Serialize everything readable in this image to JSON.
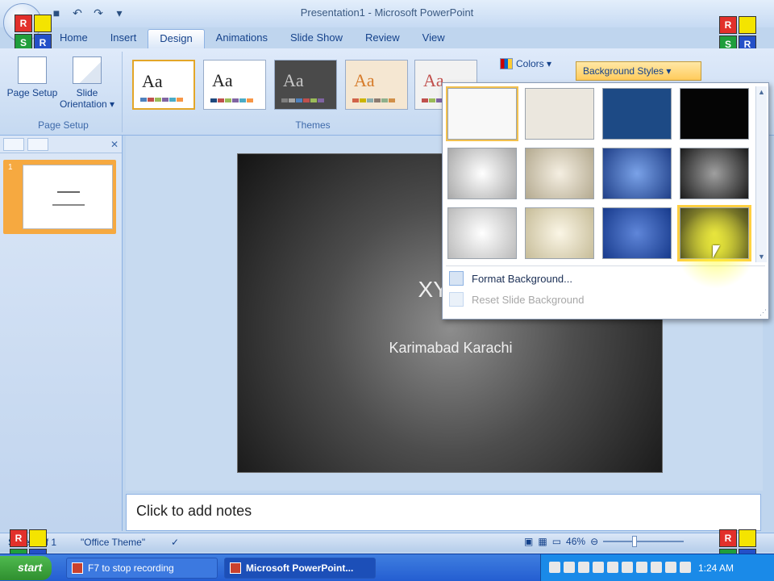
{
  "window": {
    "title": "Presentation1 - Microsoft PowerPoint",
    "controls": [
      "–",
      "□",
      "✕"
    ]
  },
  "quick_access": [
    "save-icon",
    "undo-icon",
    "redo-icon",
    "customize-icon"
  ],
  "watermark_logo": {
    "letters": [
      "R",
      "",
      "S",
      "R"
    ]
  },
  "tabs": [
    {
      "label": "Home"
    },
    {
      "label": "Insert"
    },
    {
      "label": "Design",
      "active": true
    },
    {
      "label": "Animations"
    },
    {
      "label": "Slide Show"
    },
    {
      "label": "Review"
    },
    {
      "label": "View"
    }
  ],
  "ribbon": {
    "page_setup": {
      "group_label": "Page Setup",
      "page_setup_label": "Page Setup",
      "orientation_label": "Slide Orientation ▾"
    },
    "themes": {
      "group_label": "Themes",
      "items": [
        {
          "label": "Aa",
          "bg": "#ffffff",
          "fg": "#222222",
          "bars": [
            "#4f81bd",
            "#c0504d",
            "#9bbb59",
            "#8064a2",
            "#4bacc6",
            "#f79646"
          ],
          "active": true
        },
        {
          "label": "Aa",
          "bg": "#ffffff",
          "fg": "#222222",
          "bars": [
            "#1f497d",
            "#c0504d",
            "#9bbb59",
            "#8064a2",
            "#4bacc6",
            "#f79646"
          ]
        },
        {
          "label": "Aa",
          "bg": "#4a4a4a",
          "fg": "#c8c8c8",
          "bars": [
            "#7f7f7f",
            "#a5a5a5",
            "#4f81bd",
            "#c0504d",
            "#9bbb59",
            "#8064a2"
          ]
        },
        {
          "label": "Aa",
          "bg": "#f5e7d2",
          "fg": "#d67b2a",
          "bars": [
            "#d16349",
            "#ccb400",
            "#8cadae",
            "#8c7b70",
            "#8fb08c",
            "#d19049"
          ]
        },
        {
          "label": "Aa",
          "bg": "#f2f2f2",
          "fg": "#c0504d",
          "bars": [
            "#c0504d",
            "#9bbb59",
            "#8064a2",
            "#4bacc6",
            "#f79646",
            "#4f81bd"
          ]
        }
      ]
    },
    "colors_label": "Colors ▾",
    "background_styles_label": "Background Styles ▾"
  },
  "background_gallery": {
    "swatches": [
      {
        "style": "#f8f8f8",
        "selected": true
      },
      {
        "style": "#ebe7de"
      },
      {
        "style": "#1d4a85"
      },
      {
        "style": "#050505"
      },
      {
        "style": "radial-gradient(circle at 50% 50%, #ffffff, #a8a8a8)"
      },
      {
        "style": "radial-gradient(circle at 50% 50%, #f5efe2, #b3a98f)"
      },
      {
        "style": "radial-gradient(circle at 50% 50%, #7aa2e8, #1f3f88)"
      },
      {
        "style": "radial-gradient(circle at 50% 50%, #a0a0a0, #1a1a1a)"
      },
      {
        "style": "radial-gradient(circle at 50% 50%, #ffffff, #b9b9b9)"
      },
      {
        "style": "radial-gradient(circle at 50% 50%, #fbf6e6, #c6bc98)"
      },
      {
        "style": "radial-gradient(circle at 50% 50%, #5f86d9, #173a8c)"
      },
      {
        "style": "radial-gradient(circle at 50% 50%, #d4cf3e, #4a4a1e)",
        "hover": true
      }
    ],
    "format_background_label": "Format Background...",
    "reset_background_label": "Reset Slide Background"
  },
  "slides_pane": {
    "slide_number": "1"
  },
  "slide": {
    "title": "XYZ S",
    "subtitle": "Karimabad Karachi"
  },
  "notes": {
    "placeholder": "Click to add notes"
  },
  "status_bar": {
    "slide_info": "Slide 1 of 1",
    "theme_name": "\"Office Theme\"",
    "zoom": "46%"
  },
  "taskbar": {
    "start_label": "start",
    "tasks": [
      {
        "label": "F7 to stop recording"
      },
      {
        "label": "Microsoft PowerPoint...",
        "active": true
      }
    ],
    "clock": "1:24 AM"
  },
  "colors": {
    "accent_ribbon": "#c5d9f1",
    "highlight": "#ffcb5c"
  }
}
